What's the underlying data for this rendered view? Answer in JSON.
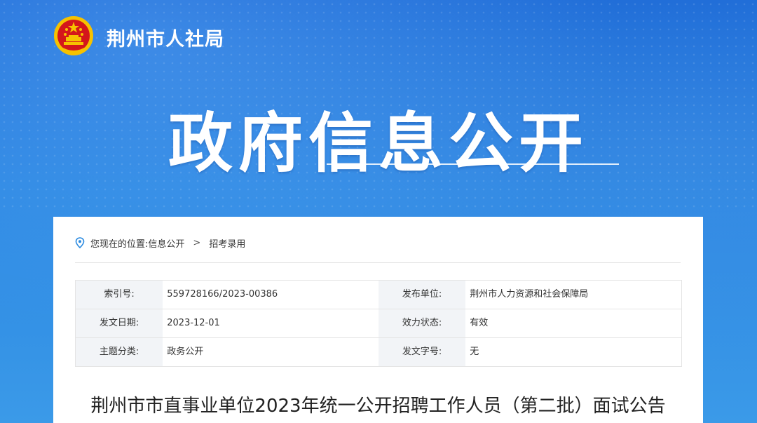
{
  "header": {
    "site_name": "荆州市人社局",
    "hero_title": "政府信息公开",
    "emblem_icon": "national-emblem-icon"
  },
  "breadcrumb": {
    "prefix": "您现在的位置:",
    "items": [
      "信息公开",
      "招考录用"
    ],
    "separator": ">"
  },
  "meta": {
    "rows": [
      {
        "k1": "索引号:",
        "v1": "559728166/2023-00386",
        "k2": "发布单位:",
        "v2": "荆州市人力资源和社会保障局"
      },
      {
        "k1": "发文日期:",
        "v1": "2023-12-01",
        "k2": "效力状态:",
        "v2": "有效"
      },
      {
        "k1": "主题分类:",
        "v1": "政务公开",
        "k2": "发文字号:",
        "v2": "无"
      }
    ]
  },
  "document": {
    "title": "荆州市市直事业单位2023年统一公开招聘工作人员（第二批）面试公告"
  },
  "colors": {
    "banner": "#1f73da",
    "accent": "#1a6fd8",
    "emblem_red": "#d4161b",
    "emblem_gold": "#f6c200"
  }
}
